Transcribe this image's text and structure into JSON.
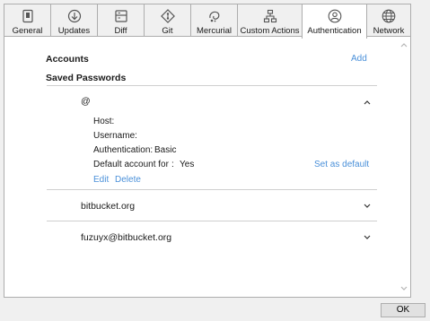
{
  "tabs": [
    {
      "label": "General",
      "icon": "general-icon",
      "active": false
    },
    {
      "label": "Updates",
      "icon": "updates-icon",
      "active": false
    },
    {
      "label": "Diff",
      "icon": "diff-icon",
      "active": false
    },
    {
      "label": "Git",
      "icon": "git-icon",
      "active": false
    },
    {
      "label": "Mercurial",
      "icon": "mercurial-icon",
      "active": false
    },
    {
      "label": "Custom Actions",
      "icon": "custom-actions-icon",
      "active": false
    },
    {
      "label": "Authentication",
      "icon": "authentication-icon",
      "active": true
    },
    {
      "label": "Network",
      "icon": "globe-icon",
      "active": false
    }
  ],
  "accounts": {
    "title": "Accounts",
    "add_label": "Add"
  },
  "saved_passwords": {
    "title": "Saved Passwords",
    "items": [
      {
        "name": "@",
        "expanded": true,
        "host_label": "Host:",
        "username_label": "Username:",
        "auth_label": "Authentication:",
        "auth_value": "Basic",
        "default_label": "Default account for",
        "default_sep": ":",
        "default_value": "Yes",
        "set_default_label": "Set as default",
        "edit_label": "Edit",
        "delete_label": "Delete"
      },
      {
        "name": "bitbucket.org",
        "expanded": false
      },
      {
        "name": "fuzuyx@bitbucket.org",
        "expanded": false
      }
    ]
  },
  "footer": {
    "ok_label": "OK"
  },
  "colors": {
    "link": "#4a90d9",
    "panel_bg": "#ffffff",
    "window_bg": "#f0f0f0",
    "border": "#adadad"
  }
}
